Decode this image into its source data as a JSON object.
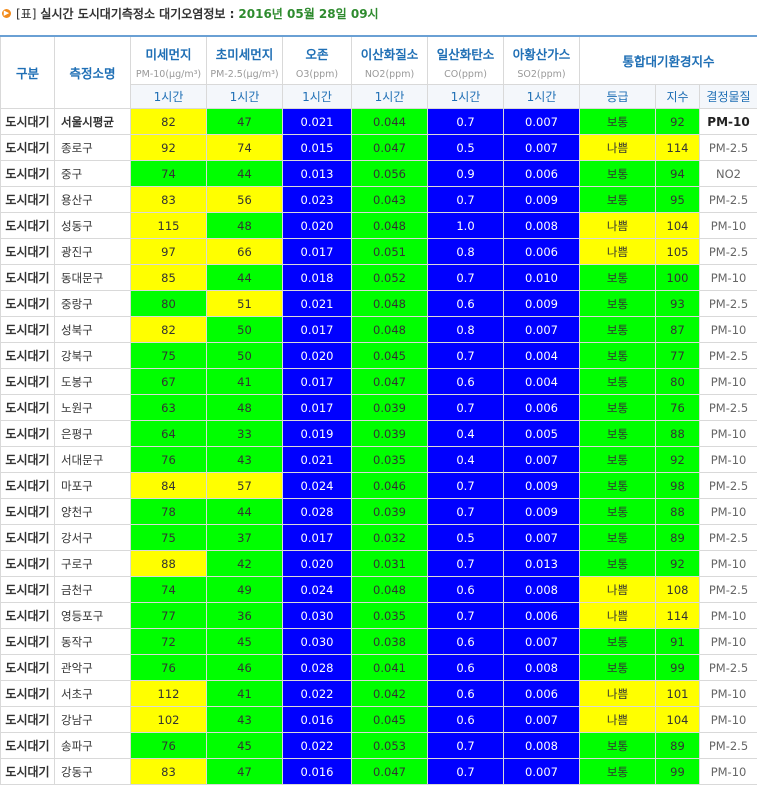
{
  "title": {
    "prefix": "[표]",
    "main": "실시간 도시대기측정소 대기오염정보 :",
    "date": "2016년 05월 28일 09시"
  },
  "headers": {
    "kind": "구분",
    "station": "측정소명",
    "pm10": {
      "label": "미세먼지",
      "unit": "PM-10(μg/m³)"
    },
    "pm25": {
      "label": "초미세먼지",
      "unit": "PM-2.5(μg/m³)"
    },
    "o3": {
      "label": "오존",
      "unit": "O3(ppm)"
    },
    "no2": {
      "label": "이산화질소",
      "unit": "NO2(ppm)"
    },
    "co": {
      "label": "일산화탄소",
      "unit": "CO(ppm)"
    },
    "so2": {
      "label": "아황산가스",
      "unit": "SO2(ppm)"
    },
    "cai": "통합대기환경지수",
    "hour": "1시간",
    "grade": "등급",
    "index": "지수",
    "determinant": "결정물질"
  },
  "colors": {
    "yellow": "#ffff00",
    "green": "#00ff00",
    "blue": "#0000ff"
  },
  "rows": [
    {
      "kind": "도시대기",
      "name": "서울시평균",
      "pm10": "82",
      "pm25": "47",
      "o3": "0.021",
      "no2": "0.044",
      "co": "0.7",
      "so2": "0.007",
      "grade": "보통",
      "index": "92",
      "det": "PM-10",
      "pm10c": "y",
      "pm25c": "g",
      "o3c": "b",
      "no2c": "g",
      "coc": "b",
      "so2c": "b",
      "gc": "g",
      "avg": true
    },
    {
      "kind": "도시대기",
      "name": "종로구",
      "pm10": "92",
      "pm25": "74",
      "o3": "0.015",
      "no2": "0.047",
      "co": "0.5",
      "so2": "0.007",
      "grade": "나쁨",
      "index": "114",
      "det": "PM-2.5",
      "pm10c": "y",
      "pm25c": "y",
      "o3c": "b",
      "no2c": "g",
      "coc": "b",
      "so2c": "b",
      "gc": "y"
    },
    {
      "kind": "도시대기",
      "name": "중구",
      "pm10": "74",
      "pm25": "44",
      "o3": "0.013",
      "no2": "0.056",
      "co": "0.9",
      "so2": "0.006",
      "grade": "보통",
      "index": "94",
      "det": "NO2",
      "pm10c": "g",
      "pm25c": "g",
      "o3c": "b",
      "no2c": "g",
      "coc": "b",
      "so2c": "b",
      "gc": "g"
    },
    {
      "kind": "도시대기",
      "name": "용산구",
      "pm10": "83",
      "pm25": "56",
      "o3": "0.023",
      "no2": "0.043",
      "co": "0.7",
      "so2": "0.009",
      "grade": "보통",
      "index": "95",
      "det": "PM-2.5",
      "pm10c": "y",
      "pm25c": "y",
      "o3c": "b",
      "no2c": "g",
      "coc": "b",
      "so2c": "b",
      "gc": "g"
    },
    {
      "kind": "도시대기",
      "name": "성동구",
      "pm10": "115",
      "pm25": "48",
      "o3": "0.020",
      "no2": "0.048",
      "co": "1.0",
      "so2": "0.008",
      "grade": "나쁨",
      "index": "104",
      "det": "PM-10",
      "pm10c": "y",
      "pm25c": "g",
      "o3c": "b",
      "no2c": "g",
      "coc": "b",
      "so2c": "b",
      "gc": "y"
    },
    {
      "kind": "도시대기",
      "name": "광진구",
      "pm10": "97",
      "pm25": "66",
      "o3": "0.017",
      "no2": "0.051",
      "co": "0.8",
      "so2": "0.006",
      "grade": "나쁨",
      "index": "105",
      "det": "PM-2.5",
      "pm10c": "y",
      "pm25c": "y",
      "o3c": "b",
      "no2c": "g",
      "coc": "b",
      "so2c": "b",
      "gc": "y"
    },
    {
      "kind": "도시대기",
      "name": "동대문구",
      "pm10": "85",
      "pm25": "44",
      "o3": "0.018",
      "no2": "0.052",
      "co": "0.7",
      "so2": "0.010",
      "grade": "보통",
      "index": "100",
      "det": "PM-10",
      "pm10c": "y",
      "pm25c": "g",
      "o3c": "b",
      "no2c": "g",
      "coc": "b",
      "so2c": "b",
      "gc": "g"
    },
    {
      "kind": "도시대기",
      "name": "중랑구",
      "pm10": "80",
      "pm25": "51",
      "o3": "0.021",
      "no2": "0.048",
      "co": "0.6",
      "so2": "0.009",
      "grade": "보통",
      "index": "93",
      "det": "PM-2.5",
      "pm10c": "g",
      "pm25c": "y",
      "o3c": "b",
      "no2c": "g",
      "coc": "b",
      "so2c": "b",
      "gc": "g"
    },
    {
      "kind": "도시대기",
      "name": "성북구",
      "pm10": "82",
      "pm25": "50",
      "o3": "0.017",
      "no2": "0.048",
      "co": "0.8",
      "so2": "0.007",
      "grade": "보통",
      "index": "87",
      "det": "PM-10",
      "pm10c": "y",
      "pm25c": "g",
      "o3c": "b",
      "no2c": "g",
      "coc": "b",
      "so2c": "b",
      "gc": "g"
    },
    {
      "kind": "도시대기",
      "name": "강북구",
      "pm10": "75",
      "pm25": "50",
      "o3": "0.020",
      "no2": "0.045",
      "co": "0.7",
      "so2": "0.004",
      "grade": "보통",
      "index": "77",
      "det": "PM-2.5",
      "pm10c": "g",
      "pm25c": "g",
      "o3c": "b",
      "no2c": "g",
      "coc": "b",
      "so2c": "b",
      "gc": "g"
    },
    {
      "kind": "도시대기",
      "name": "도봉구",
      "pm10": "67",
      "pm25": "41",
      "o3": "0.017",
      "no2": "0.047",
      "co": "0.6",
      "so2": "0.004",
      "grade": "보통",
      "index": "80",
      "det": "PM-10",
      "pm10c": "g",
      "pm25c": "g",
      "o3c": "b",
      "no2c": "g",
      "coc": "b",
      "so2c": "b",
      "gc": "g"
    },
    {
      "kind": "도시대기",
      "name": "노원구",
      "pm10": "63",
      "pm25": "48",
      "o3": "0.017",
      "no2": "0.039",
      "co": "0.7",
      "so2": "0.006",
      "grade": "보통",
      "index": "76",
      "det": "PM-2.5",
      "pm10c": "g",
      "pm25c": "g",
      "o3c": "b",
      "no2c": "g",
      "coc": "b",
      "so2c": "b",
      "gc": "g"
    },
    {
      "kind": "도시대기",
      "name": "은평구",
      "pm10": "64",
      "pm25": "33",
      "o3": "0.019",
      "no2": "0.039",
      "co": "0.4",
      "so2": "0.005",
      "grade": "보통",
      "index": "88",
      "det": "PM-10",
      "pm10c": "g",
      "pm25c": "g",
      "o3c": "b",
      "no2c": "g",
      "coc": "b",
      "so2c": "b",
      "gc": "g"
    },
    {
      "kind": "도시대기",
      "name": "서대문구",
      "pm10": "76",
      "pm25": "43",
      "o3": "0.021",
      "no2": "0.035",
      "co": "0.4",
      "so2": "0.007",
      "grade": "보통",
      "index": "92",
      "det": "PM-10",
      "pm10c": "g",
      "pm25c": "g",
      "o3c": "b",
      "no2c": "g",
      "coc": "b",
      "so2c": "b",
      "gc": "g"
    },
    {
      "kind": "도시대기",
      "name": "마포구",
      "pm10": "84",
      "pm25": "57",
      "o3": "0.024",
      "no2": "0.046",
      "co": "0.7",
      "so2": "0.009",
      "grade": "보통",
      "index": "98",
      "det": "PM-2.5",
      "pm10c": "y",
      "pm25c": "y",
      "o3c": "b",
      "no2c": "g",
      "coc": "b",
      "so2c": "b",
      "gc": "g"
    },
    {
      "kind": "도시대기",
      "name": "양천구",
      "pm10": "78",
      "pm25": "44",
      "o3": "0.028",
      "no2": "0.039",
      "co": "0.7",
      "so2": "0.009",
      "grade": "보통",
      "index": "88",
      "det": "PM-10",
      "pm10c": "g",
      "pm25c": "g",
      "o3c": "b",
      "no2c": "g",
      "coc": "b",
      "so2c": "b",
      "gc": "g"
    },
    {
      "kind": "도시대기",
      "name": "강서구",
      "pm10": "75",
      "pm25": "37",
      "o3": "0.017",
      "no2": "0.032",
      "co": "0.5",
      "so2": "0.007",
      "grade": "보통",
      "index": "89",
      "det": "PM-2.5",
      "pm10c": "g",
      "pm25c": "g",
      "o3c": "b",
      "no2c": "g",
      "coc": "b",
      "so2c": "b",
      "gc": "g"
    },
    {
      "kind": "도시대기",
      "name": "구로구",
      "pm10": "88",
      "pm25": "42",
      "o3": "0.020",
      "no2": "0.031",
      "co": "0.7",
      "so2": "0.013",
      "grade": "보통",
      "index": "92",
      "det": "PM-10",
      "pm10c": "y",
      "pm25c": "g",
      "o3c": "b",
      "no2c": "g",
      "coc": "b",
      "so2c": "b",
      "gc": "g"
    },
    {
      "kind": "도시대기",
      "name": "금천구",
      "pm10": "74",
      "pm25": "49",
      "o3": "0.024",
      "no2": "0.048",
      "co": "0.6",
      "so2": "0.008",
      "grade": "나쁨",
      "index": "108",
      "det": "PM-2.5",
      "pm10c": "g",
      "pm25c": "g",
      "o3c": "b",
      "no2c": "g",
      "coc": "b",
      "so2c": "b",
      "gc": "y"
    },
    {
      "kind": "도시대기",
      "name": "영등포구",
      "pm10": "77",
      "pm25": "36",
      "o3": "0.030",
      "no2": "0.035",
      "co": "0.7",
      "so2": "0.006",
      "grade": "나쁨",
      "index": "114",
      "det": "PM-10",
      "pm10c": "g",
      "pm25c": "g",
      "o3c": "b",
      "no2c": "g",
      "coc": "b",
      "so2c": "b",
      "gc": "y"
    },
    {
      "kind": "도시대기",
      "name": "동작구",
      "pm10": "72",
      "pm25": "45",
      "o3": "0.030",
      "no2": "0.038",
      "co": "0.6",
      "so2": "0.007",
      "grade": "보통",
      "index": "91",
      "det": "PM-10",
      "pm10c": "g",
      "pm25c": "g",
      "o3c": "b",
      "no2c": "g",
      "coc": "b",
      "so2c": "b",
      "gc": "g"
    },
    {
      "kind": "도시대기",
      "name": "관악구",
      "pm10": "76",
      "pm25": "46",
      "o3": "0.028",
      "no2": "0.041",
      "co": "0.6",
      "so2": "0.008",
      "grade": "보통",
      "index": "99",
      "det": "PM-2.5",
      "pm10c": "g",
      "pm25c": "g",
      "o3c": "b",
      "no2c": "g",
      "coc": "b",
      "so2c": "b",
      "gc": "g"
    },
    {
      "kind": "도시대기",
      "name": "서초구",
      "pm10": "112",
      "pm25": "41",
      "o3": "0.022",
      "no2": "0.042",
      "co": "0.6",
      "so2": "0.006",
      "grade": "나쁨",
      "index": "101",
      "det": "PM-10",
      "pm10c": "y",
      "pm25c": "g",
      "o3c": "b",
      "no2c": "g",
      "coc": "b",
      "so2c": "b",
      "gc": "y"
    },
    {
      "kind": "도시대기",
      "name": "강남구",
      "pm10": "102",
      "pm25": "43",
      "o3": "0.016",
      "no2": "0.045",
      "co": "0.6",
      "so2": "0.007",
      "grade": "나쁨",
      "index": "104",
      "det": "PM-10",
      "pm10c": "y",
      "pm25c": "g",
      "o3c": "b",
      "no2c": "g",
      "coc": "b",
      "so2c": "b",
      "gc": "y"
    },
    {
      "kind": "도시대기",
      "name": "송파구",
      "pm10": "76",
      "pm25": "45",
      "o3": "0.022",
      "no2": "0.053",
      "co": "0.7",
      "so2": "0.008",
      "grade": "보통",
      "index": "89",
      "det": "PM-2.5",
      "pm10c": "g",
      "pm25c": "g",
      "o3c": "b",
      "no2c": "g",
      "coc": "b",
      "so2c": "b",
      "gc": "g"
    },
    {
      "kind": "도시대기",
      "name": "강동구",
      "pm10": "83",
      "pm25": "47",
      "o3": "0.016",
      "no2": "0.047",
      "co": "0.7",
      "so2": "0.007",
      "grade": "보통",
      "index": "99",
      "det": "PM-10",
      "pm10c": "y",
      "pm25c": "g",
      "o3c": "b",
      "no2c": "g",
      "coc": "b",
      "so2c": "b",
      "gc": "g"
    }
  ]
}
